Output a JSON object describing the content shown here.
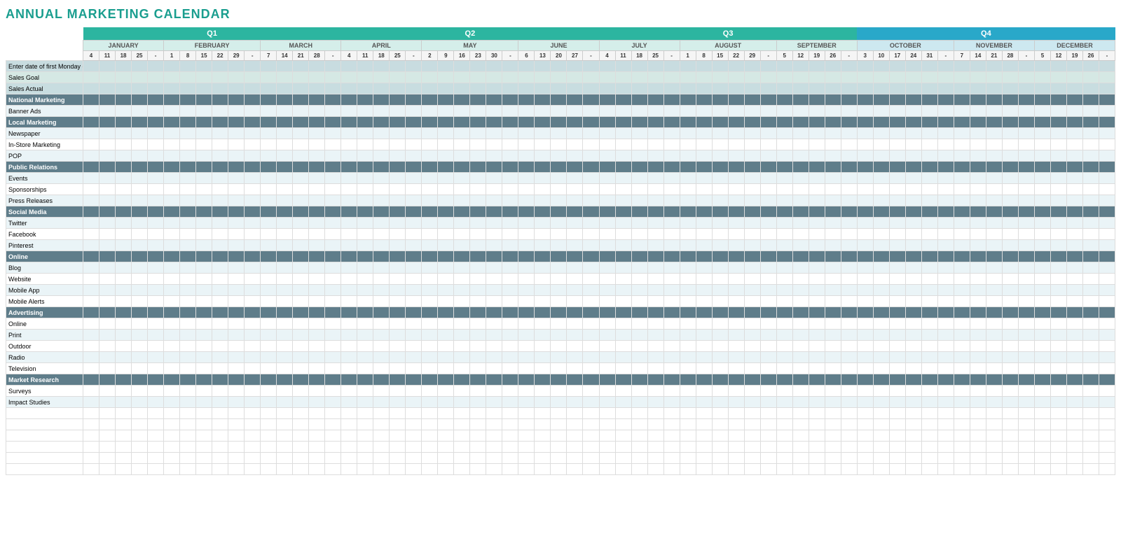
{
  "title": "ANNUAL MARKETING CALENDAR",
  "quarters": [
    {
      "label": "Q1",
      "color": "q1-color",
      "colspan": 18
    },
    {
      "label": "Q2",
      "color": "q2-color",
      "colspan": 18
    },
    {
      "label": "Q3",
      "color": "q3-color",
      "colspan": 18
    },
    {
      "label": "Q4",
      "color": "q4-color",
      "colspan": 18
    }
  ],
  "months": [
    {
      "label": "JANUARY",
      "days": [
        4,
        11,
        18,
        25
      ],
      "class": "month-jan"
    },
    {
      "label": "FEBRUARY",
      "days": [
        1,
        8,
        15,
        22,
        29
      ],
      "class": "month-feb"
    },
    {
      "label": "MARCH",
      "days": [
        7,
        14,
        21,
        28
      ],
      "class": "month-mar"
    },
    {
      "label": "APRIL",
      "days": [
        4,
        11,
        18,
        25
      ],
      "class": "month-apr"
    },
    {
      "label": "MAY",
      "days": [
        2,
        9,
        16,
        23,
        30
      ],
      "class": "month-may"
    },
    {
      "label": "JUNE",
      "days": [
        6,
        13,
        20,
        27
      ],
      "class": "month-jun"
    },
    {
      "label": "JULY",
      "days": [
        4,
        11,
        18,
        25
      ],
      "class": "month-jul"
    },
    {
      "label": "AUGUST",
      "days": [
        1,
        8,
        15,
        22,
        29
      ],
      "class": "month-aug"
    },
    {
      "label": "SEPTEMBER",
      "days": [
        5,
        12,
        19,
        26
      ],
      "class": "month-sep"
    },
    {
      "label": "OCTOBER",
      "days": [
        3,
        10,
        17,
        24,
        31
      ],
      "class": "month-oct"
    },
    {
      "label": "NOVEMBER",
      "days": [
        7,
        14,
        21,
        28
      ],
      "class": "month-nov"
    },
    {
      "label": "DECEMBER",
      "days": [
        5,
        12,
        19,
        26
      ],
      "class": "month-dec"
    }
  ],
  "firstMondayLabel": "Enter date of first Monday each month",
  "rows": [
    {
      "label": "Sales Goal",
      "type": "sales-goal"
    },
    {
      "label": "Sales Actual",
      "type": "sales-actual"
    },
    {
      "label": "National Marketing",
      "type": "header"
    },
    {
      "label": "Banner Ads",
      "type": "normal"
    },
    {
      "label": "Local Marketing",
      "type": "header"
    },
    {
      "label": "Newspaper",
      "type": "normal"
    },
    {
      "label": "In-Store Marketing",
      "type": "normal"
    },
    {
      "label": "POP",
      "type": "normal"
    },
    {
      "label": "Public Relations",
      "type": "header"
    },
    {
      "label": "Events",
      "type": "normal"
    },
    {
      "label": "Sponsorships",
      "type": "normal"
    },
    {
      "label": "Press Releases",
      "type": "normal"
    },
    {
      "label": "Social Media",
      "type": "header"
    },
    {
      "label": "Twitter",
      "type": "normal"
    },
    {
      "label": "Facebook",
      "type": "normal"
    },
    {
      "label": "Pinterest",
      "type": "normal"
    },
    {
      "label": "Online",
      "type": "header"
    },
    {
      "label": "Blog",
      "type": "normal"
    },
    {
      "label": "Website",
      "type": "normal"
    },
    {
      "label": "Mobile App",
      "type": "normal"
    },
    {
      "label": "Mobile Alerts",
      "type": "normal"
    },
    {
      "label": "Advertising",
      "type": "header"
    },
    {
      "label": "Online",
      "type": "normal"
    },
    {
      "label": "Print",
      "type": "normal"
    },
    {
      "label": "Outdoor",
      "type": "normal"
    },
    {
      "label": "Radio",
      "type": "normal"
    },
    {
      "label": "Television",
      "type": "normal"
    },
    {
      "label": "Market Research",
      "type": "header"
    },
    {
      "label": "Surveys",
      "type": "normal"
    },
    {
      "label": "Impact Studies",
      "type": "normal"
    },
    {
      "label": "",
      "type": "empty"
    },
    {
      "label": "",
      "type": "empty"
    },
    {
      "label": "",
      "type": "empty"
    },
    {
      "label": "",
      "type": "empty"
    },
    {
      "label": "",
      "type": "empty"
    },
    {
      "label": "",
      "type": "empty"
    }
  ]
}
